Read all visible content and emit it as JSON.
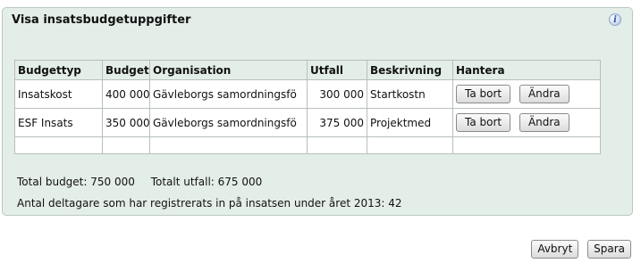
{
  "panel": {
    "title": "Visa insatsbudgetuppgifter",
    "info_icon": "info-icon"
  },
  "table": {
    "headers": [
      "Budgettyp",
      "Budget",
      "Organisation",
      "Utfall",
      "Beskrivning",
      "Hantera"
    ],
    "rows": [
      {
        "budgettyp": "Insatskost",
        "budget": "400 000",
        "organisation": "Gävleborgs samordningsfö",
        "utfall": "300 000",
        "beskrivning": "Startkostn",
        "delete_label": "Ta bort",
        "edit_label": "Ändra"
      },
      {
        "budgettyp": "ESF Insats",
        "budget": "350 000",
        "organisation": "Gävleborgs samordningsfö",
        "utfall": "375 000",
        "beskrivning": "Projektmed",
        "delete_label": "Ta bort",
        "edit_label": "Ändra"
      }
    ]
  },
  "summary": {
    "total_budget": "Total budget: 750 000",
    "total_outcome": "Totalt utfall: 675 000",
    "participants": "Antal deltagare som har registrerats in på insatsen under året 2013: 42"
  },
  "footer": {
    "cancel_label": "Avbryt",
    "save_label": "Spara"
  }
}
